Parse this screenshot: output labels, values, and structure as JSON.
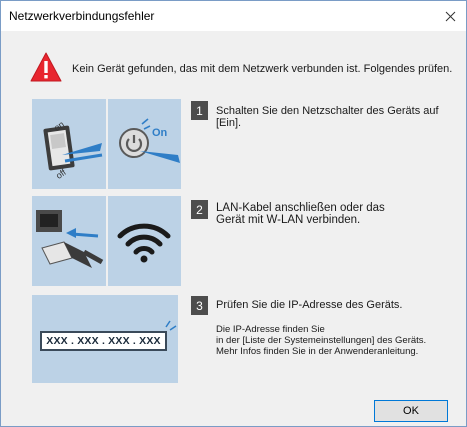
{
  "dialog": {
    "title": "Netzwerkverbindungsfehler",
    "message": "Kein Gerät gefunden, das mit dem Netzwerk verbunden ist. Folgendes prüfen."
  },
  "steps": [
    {
      "number": "1",
      "text": "Schalten Sie den Netzschalter des Geräts auf [Ein]."
    },
    {
      "number": "2",
      "line1": "LAN-Kabel anschließen oder das",
      "line2": "Gerät mit W-LAN verbinden."
    },
    {
      "number": "3",
      "text": "Prüfen Sie die IP-Adresse des Geräts.",
      "detail1": "Die IP-Adresse finden Sie",
      "detail2": "in der [Liste der Systemeinstellungen] des Geräts.",
      "detail3": "Mehr Infos finden Sie in der Anwenderanleitung."
    }
  ],
  "illustrations": {
    "switch_on_label": "on",
    "switch_off_label": "off",
    "power_on_label": "On",
    "ip_placeholder": "XXX . XXX . XXX . XXX"
  },
  "buttons": {
    "ok": "OK"
  },
  "colors": {
    "panel": "#bcd2e6",
    "warning": "#e8262f",
    "accent": "#0078d7"
  }
}
